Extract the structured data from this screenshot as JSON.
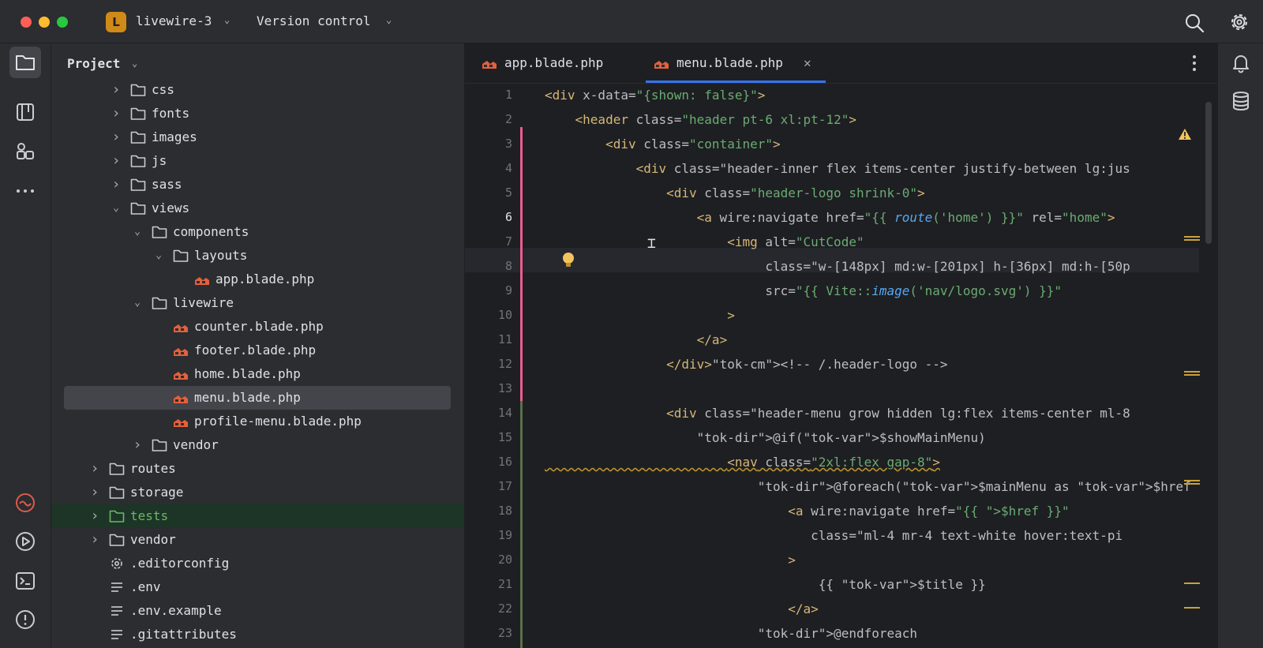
{
  "titlebar": {
    "project_badge": "L",
    "project_name": "livewire-3",
    "vcs_label": "Version control",
    "icons": [
      "search-icon",
      "gear-icon"
    ]
  },
  "left_strip": {
    "icons": [
      "folder-icon",
      "structure-icon",
      "plugins-icon",
      "more-icon",
      "laravel-icon",
      "run-icon",
      "terminal-icon",
      "problems-icon"
    ]
  },
  "project_panel": {
    "title": "Project",
    "tree": [
      {
        "label": "css",
        "type": "folder",
        "depth": 2,
        "expanded": false
      },
      {
        "label": "fonts",
        "type": "folder",
        "depth": 2,
        "expanded": false
      },
      {
        "label": "images",
        "type": "folder",
        "depth": 2,
        "expanded": false
      },
      {
        "label": "js",
        "type": "folder",
        "depth": 2,
        "expanded": false
      },
      {
        "label": "sass",
        "type": "folder",
        "depth": 2,
        "expanded": false
      },
      {
        "label": "views",
        "type": "folder",
        "depth": 2,
        "expanded": true
      },
      {
        "label": "components",
        "type": "folder",
        "depth": 3,
        "expanded": true
      },
      {
        "label": "layouts",
        "type": "folder",
        "depth": 4,
        "expanded": true
      },
      {
        "label": "app.blade.php",
        "type": "blade",
        "depth": 5
      },
      {
        "label": "livewire",
        "type": "folder",
        "depth": 3,
        "expanded": true
      },
      {
        "label": "counter.blade.php",
        "type": "blade",
        "depth": 4
      },
      {
        "label": "footer.blade.php",
        "type": "blade",
        "depth": 4
      },
      {
        "label": "home.blade.php",
        "type": "blade",
        "depth": 4
      },
      {
        "label": "menu.blade.php",
        "type": "blade",
        "depth": 4,
        "selected": true
      },
      {
        "label": "profile-menu.blade.php",
        "type": "blade",
        "depth": 4
      },
      {
        "label": "vendor",
        "type": "folder",
        "depth": 3,
        "expanded": false
      },
      {
        "label": "routes",
        "type": "folder",
        "depth": 1,
        "expanded": false
      },
      {
        "label": "storage",
        "type": "folder",
        "depth": 1,
        "expanded": false
      },
      {
        "label": "tests",
        "type": "folder-green",
        "depth": 1,
        "expanded": false,
        "highlighted": true
      },
      {
        "label": "vendor",
        "type": "folder",
        "depth": 1,
        "expanded": false
      },
      {
        "label": ".editorconfig",
        "type": "config",
        "depth": 1
      },
      {
        "label": ".env",
        "type": "text",
        "depth": 1
      },
      {
        "label": ".env.example",
        "type": "text",
        "depth": 1
      },
      {
        "label": ".gitattributes",
        "type": "text",
        "depth": 1
      }
    ]
  },
  "editor": {
    "tabs": [
      {
        "label": "app.blade.php",
        "active": false
      },
      {
        "label": "menu.blade.php",
        "active": true
      }
    ],
    "current_line": 6,
    "line_numbers": [
      "1",
      "2",
      "3",
      "4",
      "5",
      "6",
      "7",
      "8",
      "9",
      "10",
      "11",
      "12",
      "13",
      "14",
      "15",
      "16",
      "17",
      "18",
      "19",
      "20",
      "21",
      "22",
      "23"
    ],
    "lines": [
      "<div x-data=\"{shown: false}\">",
      "    <header class=\"header pt-6 xl:pt-12\">",
      "        <div class=\"container\">",
      "            <div class=\"header-inner flex items-center justify-between lg:jus",
      "                <div class=\"header-logo shrink-0\">",
      "                    <a wire:navigate href=\"{{ route('home') }}\" rel=\"home\">",
      "                        <img alt=\"CutCode\"",
      "                             class=\"w-[148px] md:w-[201px] h-[36px] md:h-[50p",
      "                             src=\"{{ Vite::image('nav/logo.svg') }}\"",
      "                        >",
      "                    </a>",
      "                </div><!-- /.header-logo -->",
      "",
      "                <div class=\"header-menu grow hidden lg:flex items-center ml-8",
      "                    @if($showMainMenu)",
      "                        <nav class=\"2xl:flex gap-8\">",
      "                            @foreach($mainMenu as $href => $title)",
      "                                <a wire:navigate href=\"{{ $href }}\"",
      "                                   class=\"ml-4 mr-4 text-white hover:text-pi",
      "                                >",
      "                                    {{ $title }}",
      "                                </a>",
      "                            @endforeach"
    ]
  },
  "right_strip": {
    "icons": [
      "notifications-icon",
      "database-icon"
    ]
  }
}
